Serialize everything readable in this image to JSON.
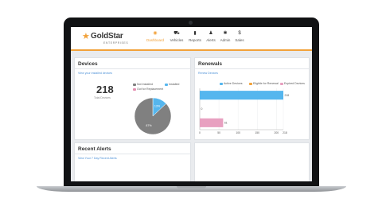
{
  "nav": {
    "logo_text": "GoldStar",
    "logo_sub": "ENTERPRISES",
    "items": [
      {
        "label": "Dashboard",
        "icon": "dashboard-icon"
      },
      {
        "label": "Vehicles",
        "icon": "car-icon"
      },
      {
        "label": "Reports",
        "icon": "bar-chart-icon"
      },
      {
        "label": "Alerts",
        "icon": "bell-icon"
      },
      {
        "label": "Admin",
        "icon": "gear-icon"
      },
      {
        "label": "Sales",
        "icon": "dollar-icon"
      }
    ]
  },
  "devices": {
    "title": "Devices",
    "link": "View your installed devices",
    "total": "218",
    "total_label": "Total Devices",
    "legend": [
      "Not Installed",
      "Installed",
      "Out for Replacement"
    ],
    "pie_labels": [
      "13%",
      "87%"
    ],
    "pie_fractions": [
      0.13,
      0.87
    ],
    "colors": {
      "not_installed": "#808080",
      "installed": "#55b6ee",
      "replacement": "#e58fb1"
    }
  },
  "renewals": {
    "title": "Renewals",
    "link": "Renew Devices",
    "legend": [
      "Active Devices",
      "Eligible for Renewal",
      "Expired Devices"
    ],
    "colors": {
      "active": "#55b6ee",
      "eligible": "#f2a23a",
      "expired": "#e8a0c0"
    }
  },
  "alerts": {
    "title": "Recent Alerts",
    "link": "View Your 7 Day Recent Alerts"
  },
  "chart_data": {
    "type": "bar",
    "orientation": "horizontal",
    "categories": [
      "Active Devices",
      "Eligible for Renewal",
      "Expired Devices"
    ],
    "values": [
      218,
      0,
      61
    ],
    "value_labels": [
      "218",
      "0",
      "61"
    ],
    "xlim": [
      0,
      218
    ],
    "xticks": [
      "0",
      "50",
      "100",
      "150",
      "200",
      "218"
    ],
    "legend": "top",
    "grid": true
  }
}
